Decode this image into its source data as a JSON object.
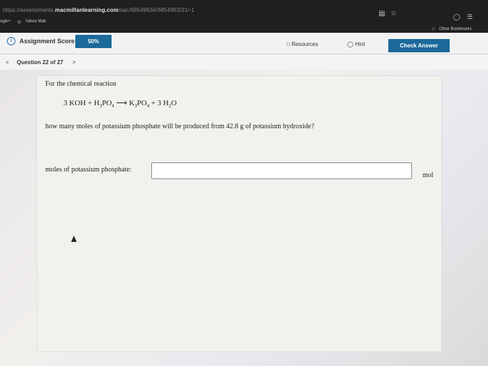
{
  "browser": {
    "url_prefix": "https://assessments.",
    "url_host": "macmillanlearning.com",
    "url_path": "/sac/6854963#/6854963/21/-1",
    "bookmarks": [
      "ogle+",
      "Yahoo Mail"
    ],
    "other_bookmarks": "Other Bookmarks"
  },
  "header": {
    "score_label": "Assignment Score:",
    "score_value": "50%",
    "resources": "Resources",
    "hint": "Hint",
    "check_answer": "Check Answer"
  },
  "nav": {
    "prev": "<",
    "question": "Question 22 of 27",
    "next": ">"
  },
  "problem": {
    "intro": "For the chemical reaction",
    "question": "how many moles of potassium phosphate will be produced from 42.8 g of potassium hydroxide?",
    "answer_label": "moles of potassium phosphate:",
    "answer_value": "",
    "unit": "mol"
  },
  "colors": {
    "accent": "#1b6a9a"
  }
}
